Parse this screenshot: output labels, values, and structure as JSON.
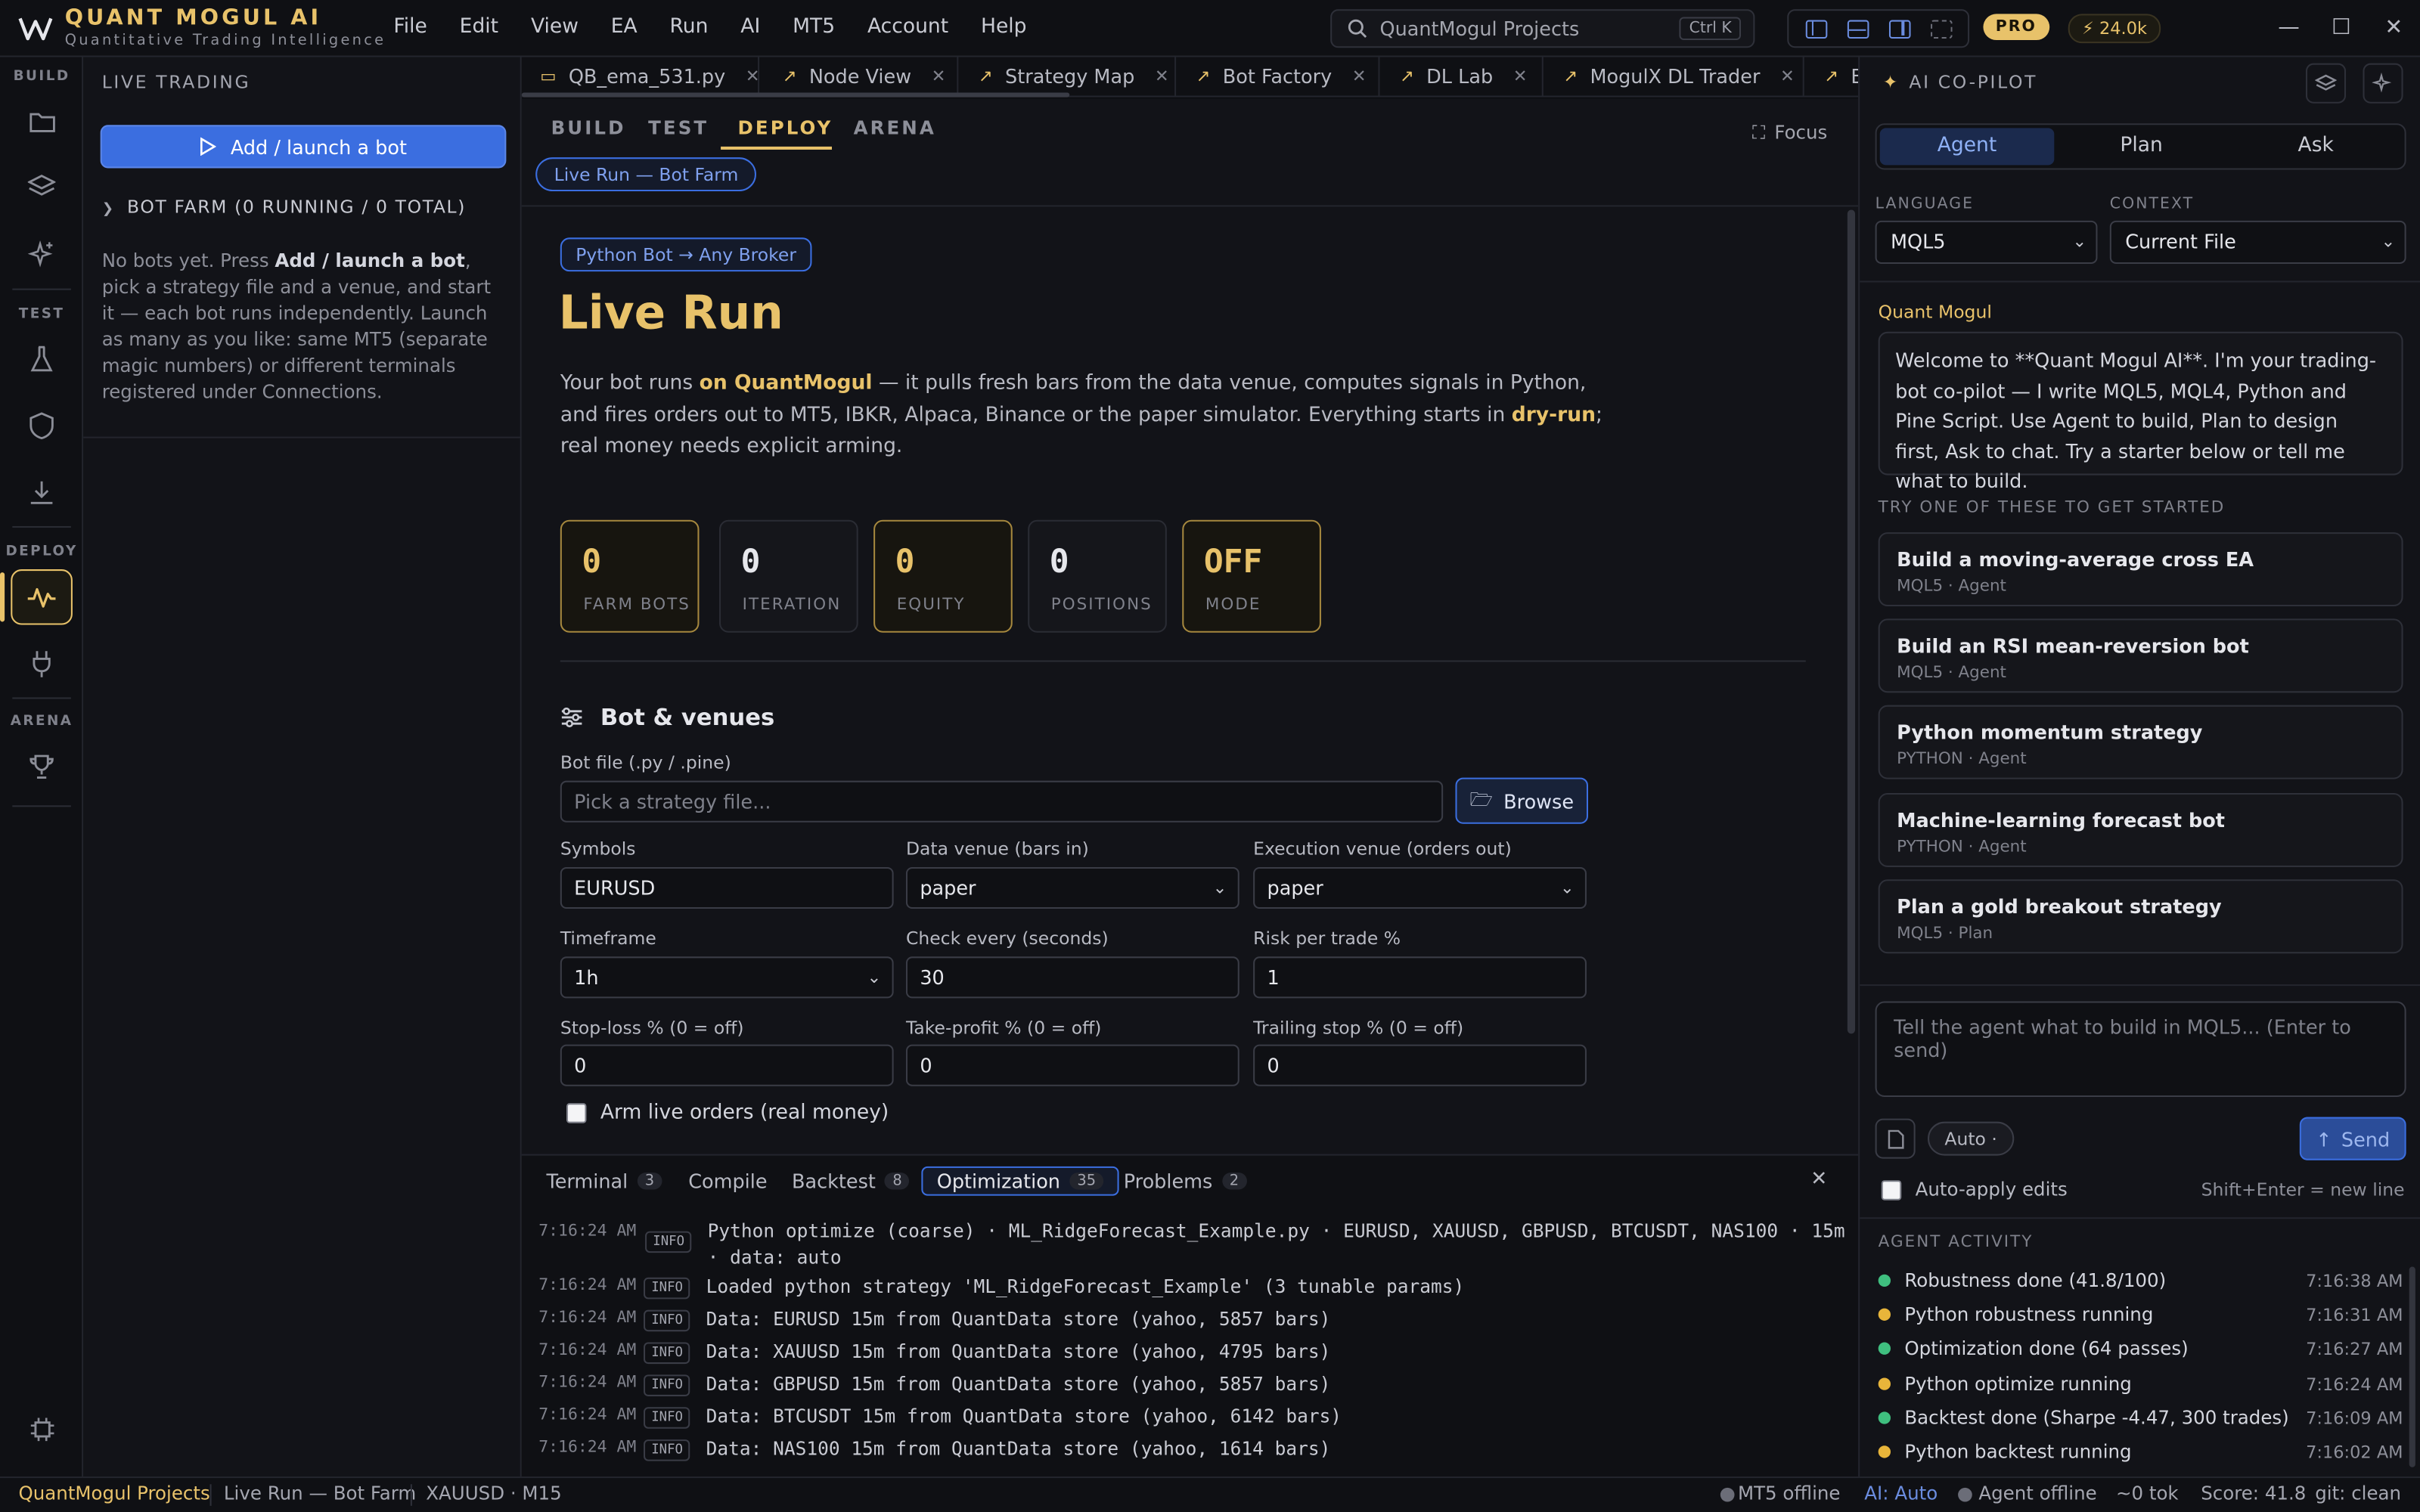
{
  "app": {
    "name": "QUANT MOGUL AI",
    "tagline": "Quantitative Trading Intelligence"
  },
  "menu": [
    "File",
    "Edit",
    "View",
    "EA",
    "Run",
    "AI",
    "MT5",
    "Account",
    "Help"
  ],
  "search": {
    "placeholder": "QuantMogul Projects",
    "shortcut": "Ctrl K"
  },
  "badges": {
    "plan": "PRO",
    "tokens": "24.0k"
  },
  "activity": {
    "sections": [
      "BUILD",
      "TEST",
      "DEPLOY",
      "ARENA"
    ]
  },
  "sidebar": {
    "title": "LIVE TRADING",
    "add_button": "Add / launch a bot",
    "farm_header": "BOT FARM (0 RUNNING / 0 TOTAL)",
    "empty_pre": "No bots yet. Press ",
    "empty_bold": "Add / launch a bot",
    "empty_post": ", pick a strategy file and a venue, and start it — each bot runs independently. Launch as many as you like: same MT5 (separate magic numbers) or different terminals registered under Connections."
  },
  "tabs": [
    "QB_ema_531.py",
    "Node View",
    "Strategy Map",
    "Bot Factory",
    "DL Lab",
    "MogulX DL Trader",
    "B"
  ],
  "subtabs": {
    "items": [
      "BUILD",
      "TEST",
      "DEPLOY",
      "ARENA"
    ],
    "active": "DEPLOY",
    "focus": "Focus",
    "chip": "Live Run — Bot Farm"
  },
  "content": {
    "chip": "Python Bot → Any Broker",
    "title": "Live Run",
    "intro": {
      "p1": "Your bot runs ",
      "b1": "on QuantMogul",
      "p2": " — it pulls fresh bars from the data venue, computes signals in Python, and fires orders out to MT5, IBKR, Alpaca, Binance or the paper simulator. Everything starts in ",
      "b2": "dry-run",
      "p3": "; real money needs explicit arming."
    },
    "stats": [
      {
        "value": "0",
        "label": "FARM BOTS"
      },
      {
        "value": "0",
        "label": "ITERATION"
      },
      {
        "value": "0",
        "label": "EQUITY"
      },
      {
        "value": "0",
        "label": "POSITIONS"
      },
      {
        "value": "OFF",
        "label": "MODE"
      }
    ],
    "section_title": "Bot & venues",
    "form": {
      "botfile_label": "Bot file (.py / .pine)",
      "botfile_placeholder": "Pick a strategy file...",
      "browse": "Browse",
      "symbols_label": "Symbols",
      "symbols_value": "EURUSD",
      "data_venue_label": "Data venue (bars in)",
      "data_venue_value": "paper",
      "exec_venue_label": "Execution venue (orders out)",
      "exec_venue_value": "paper",
      "timeframe_label": "Timeframe",
      "timeframe_value": "1h",
      "check_label": "Check every (seconds)",
      "check_value": "30",
      "risk_label": "Risk per trade %",
      "risk_value": "1",
      "sl_label": "Stop-loss % (0 = off)",
      "sl_value": "0",
      "tp_label": "Take-profit % (0 = off)",
      "tp_value": "0",
      "ts_label": "Trailing stop % (0 = off)",
      "ts_value": "0",
      "arm_label": "Arm live orders (real money)"
    }
  },
  "bottom": {
    "tabs": [
      {
        "label": "Terminal",
        "count": "3"
      },
      {
        "label": "Compile",
        "count": ""
      },
      {
        "label": "Backtest",
        "count": "8"
      },
      {
        "label": "Optimization",
        "count": "35"
      },
      {
        "label": "Problems",
        "count": "2"
      }
    ],
    "logs": [
      {
        "ts": "7:16:24 AM",
        "level": "INFO",
        "msg": "Python optimize (coarse) · ML_RidgeForecast_Example.py · EURUSD, XAUUSD, GBPUSD, BTCUSDT, NAS100 · 15m",
        "msg2": "· data: auto"
      },
      {
        "ts": "7:16:24 AM",
        "level": "INFO",
        "msg": "Loaded python strategy 'ML_RidgeForecast_Example' (3 tunable params)"
      },
      {
        "ts": "7:16:24 AM",
        "level": "INFO",
        "msg": "Data: EURUSD 15m from QuantData store (yahoo, 5857 bars)"
      },
      {
        "ts": "7:16:24 AM",
        "level": "INFO",
        "msg": "Data: XAUUSD 15m from QuantData store (yahoo, 4795 bars)"
      },
      {
        "ts": "7:16:24 AM",
        "level": "INFO",
        "msg": "Data: GBPUSD 15m from QuantData store (yahoo, 5857 bars)"
      },
      {
        "ts": "7:16:24 AM",
        "level": "INFO",
        "msg": "Data: BTCUSDT 15m from QuantData store (yahoo, 6142 bars)"
      },
      {
        "ts": "7:16:24 AM",
        "level": "INFO",
        "msg": "Data: NAS100 15m from QuantData store (yahoo, 1614 bars)"
      }
    ]
  },
  "copilot": {
    "title": "AI CO-PILOT",
    "modes": [
      "Agent",
      "Plan",
      "Ask"
    ],
    "language_label": "LANGUAGE",
    "language_value": "MQL5",
    "context_label": "CONTEXT",
    "context_value": "Current File",
    "sender": "Quant Mogul",
    "welcome": "Welcome to **Quant Mogul AI**. I'm your trading-bot co-pilot — I write MQL5, MQL4, Python and Pine Script. Use Agent to build, Plan to design first, Ask to chat. Try a starter below or tell me what to build.",
    "try_label": "TRY ONE OF THESE TO GET STARTED",
    "starters": [
      {
        "title": "Build a moving-average cross EA",
        "sub": "MQL5 · Agent"
      },
      {
        "title": "Build an RSI mean-reversion bot",
        "sub": "MQL5 · Agent"
      },
      {
        "title": "Python momentum strategy",
        "sub": "PYTHON · Agent"
      },
      {
        "title": "Machine-learning forecast bot",
        "sub": "PYTHON · Agent"
      },
      {
        "title": "Plan a gold breakout strategy",
        "sub": "MQL5 · Plan"
      }
    ],
    "prompt_placeholder": "Tell the agent what to build in MQL5...  (Enter to send)",
    "auto_label": "Auto ·",
    "send_label": "Send",
    "autoapply_label": "Auto-apply edits",
    "newline_hint": "Shift+Enter = new line",
    "activity_label": "AGENT ACTIVITY",
    "activity": [
      {
        "text": "Robustness done (41.8/100)",
        "time": "7:16:38 AM",
        "status": "done"
      },
      {
        "text": "Python robustness running",
        "time": "7:16:31 AM",
        "status": "running"
      },
      {
        "text": "Optimization done (64 passes)",
        "time": "7:16:27 AM",
        "status": "done"
      },
      {
        "text": "Python optimize running",
        "time": "7:16:24 AM",
        "status": "running"
      },
      {
        "text": "Backtest done (Sharpe -4.47, 300 trades)",
        "time": "7:16:09 AM",
        "status": "done"
      },
      {
        "text": "Python backtest running",
        "time": "7:16:02 AM",
        "status": "running"
      }
    ]
  },
  "status": {
    "project": "QuantMogul Projects",
    "view": "Live Run — Bot Farm",
    "symbol": "XAUUSD · M15",
    "mt5": "MT5 offline",
    "ai": "AI: Auto",
    "agent": "Agent offline",
    "tokens": "~0 tok",
    "score": "Score: 41.8",
    "git": "git: clean"
  },
  "colors": {
    "accent_gold": "#e8c26a",
    "accent_blue": "#3b6ee0",
    "done": "#3fbf7f",
    "running": "#e8b53a"
  }
}
